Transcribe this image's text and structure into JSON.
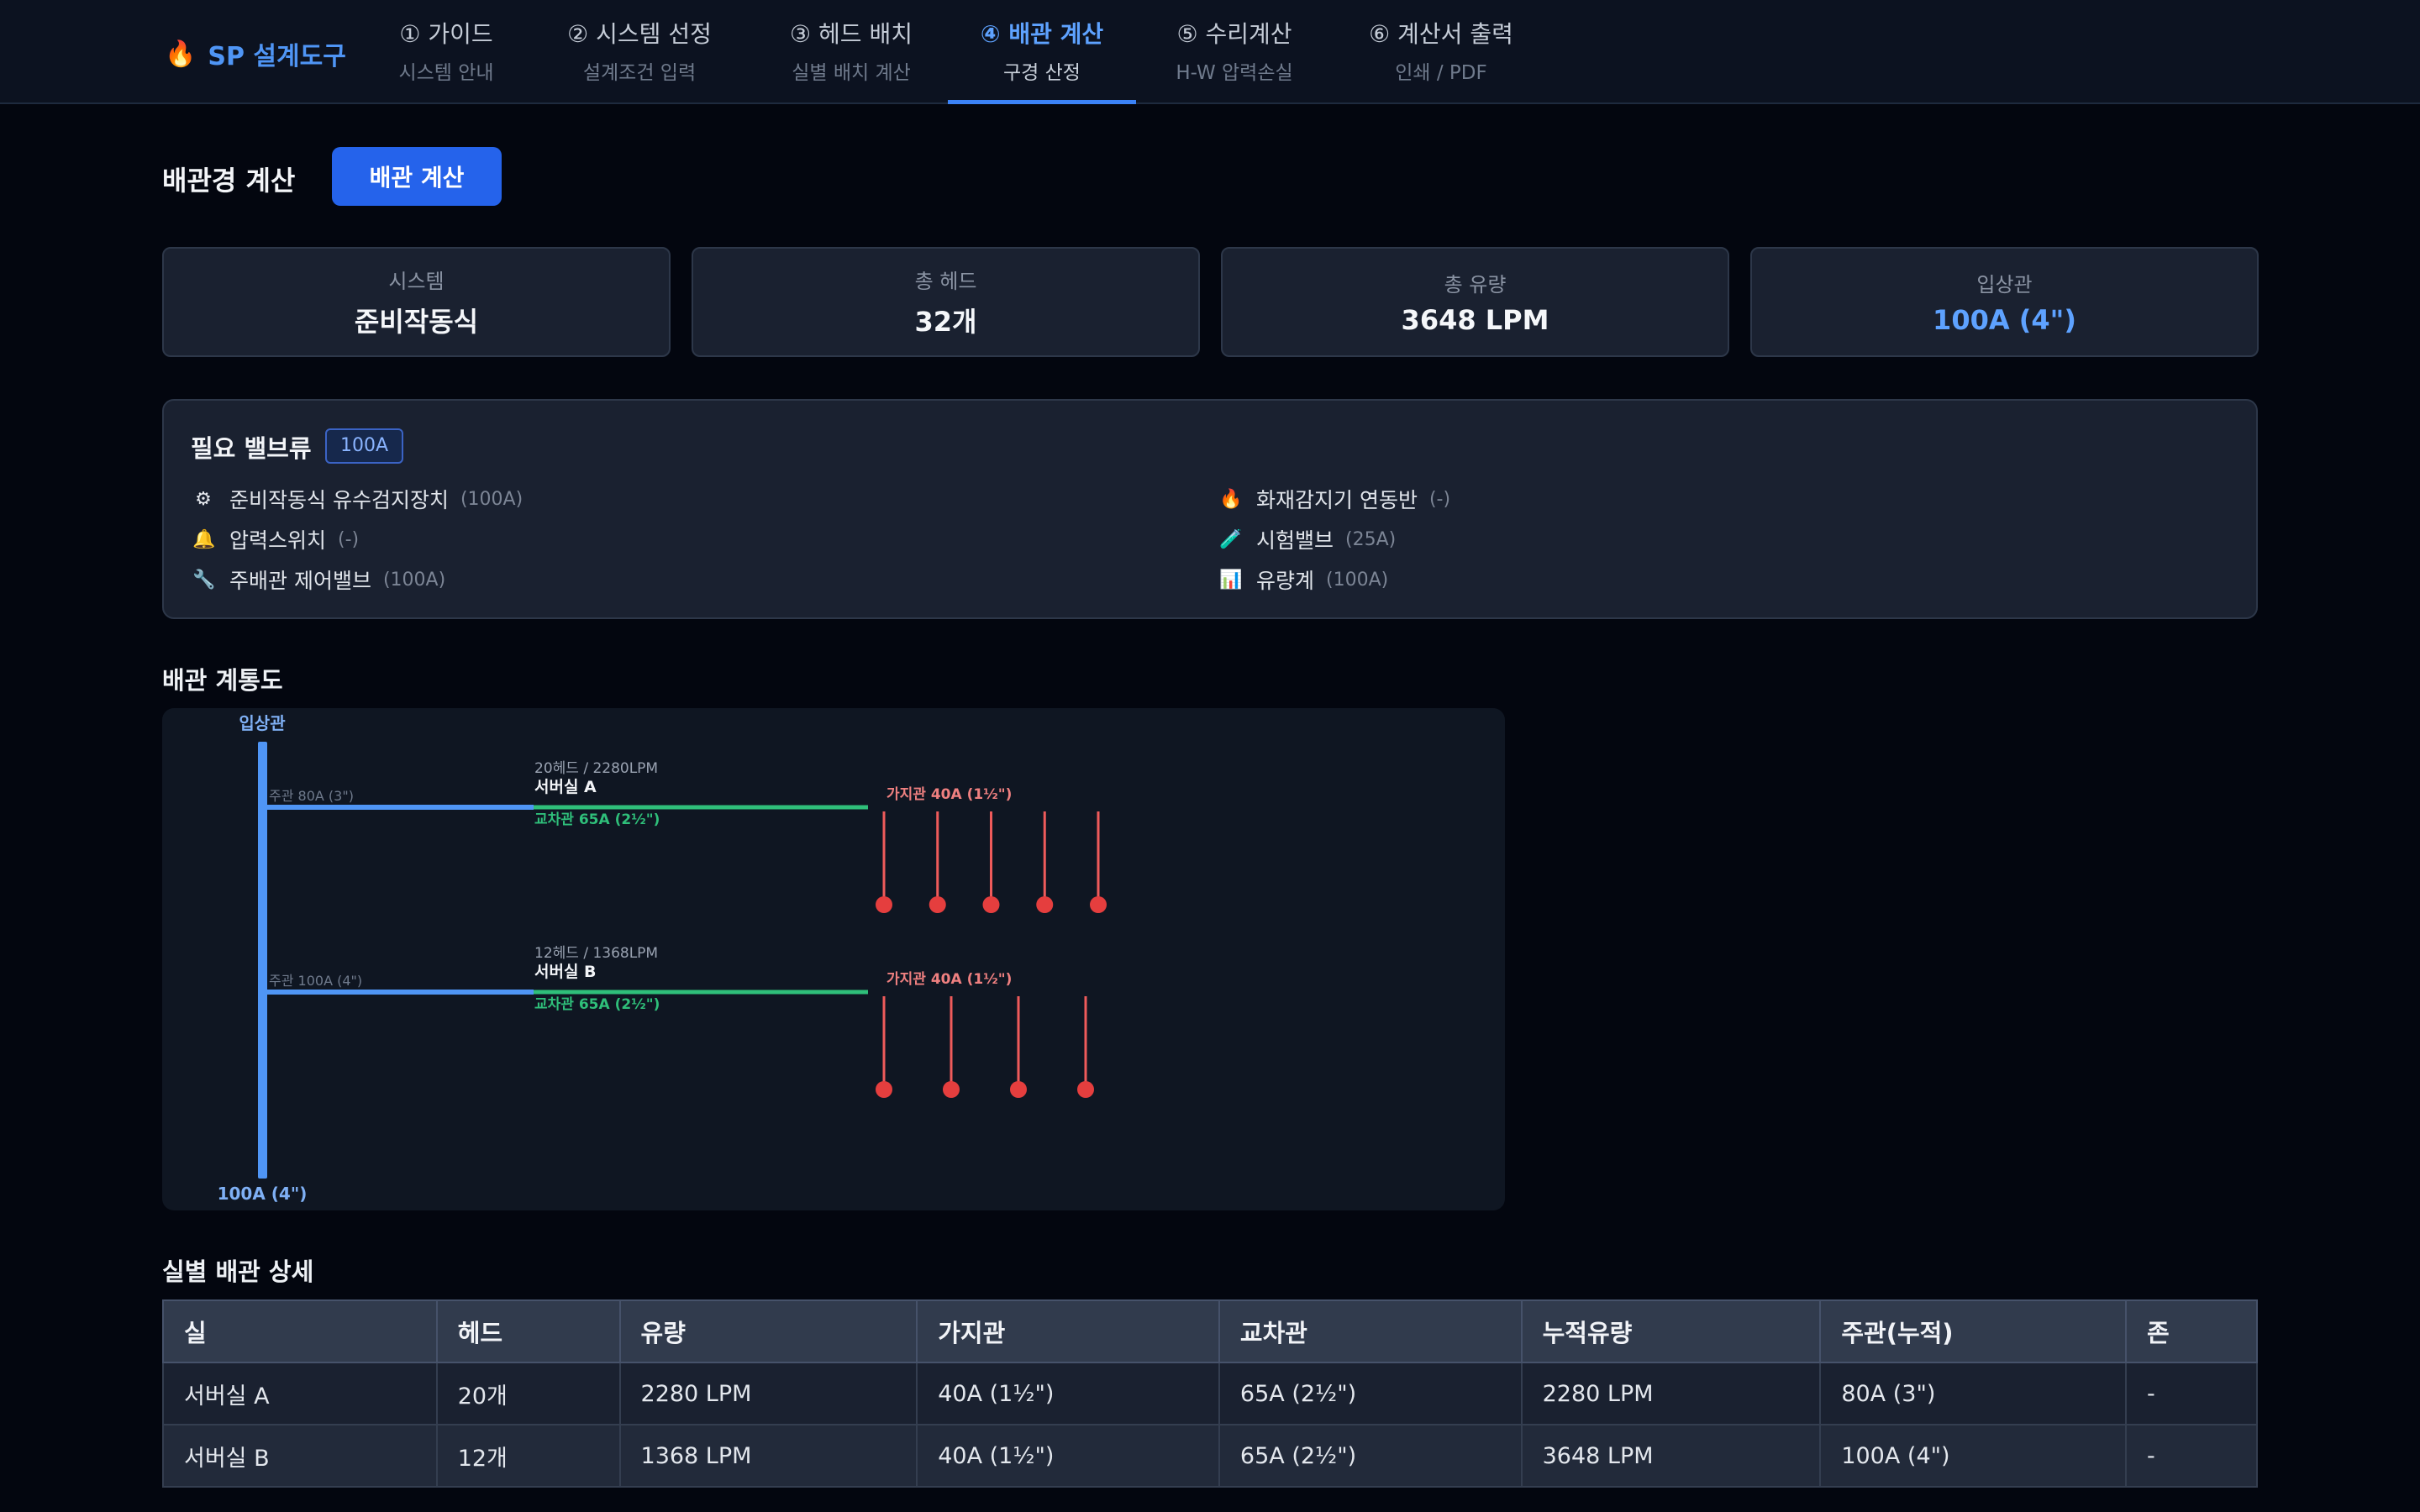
{
  "brand": {
    "icon": "flame-icon",
    "name": "SP 설계도구"
  },
  "tabs": [
    {
      "label": "① 가이드",
      "sub": "시스템 안내",
      "active": false
    },
    {
      "label": "② 시스템 선정",
      "sub": "설계조건 입력",
      "active": false
    },
    {
      "label": "③ 헤드 배치",
      "sub": "실별 배치 계산",
      "active": false
    },
    {
      "label": "④ 배관 계산",
      "sub": "구경 산정",
      "active": true
    },
    {
      "label": "⑤ 수리계산",
      "sub": "H-W 압력손실",
      "active": false
    },
    {
      "label": "⑥ 계산서 출력",
      "sub": "인쇄 / PDF",
      "active": false
    }
  ],
  "main": {
    "title": "배관경 계산",
    "calc_button": "배관 계산",
    "cards": [
      {
        "label": "시스템",
        "value": "준비작동식",
        "accent": false
      },
      {
        "label": "총 헤드",
        "value": "32개",
        "accent": false
      },
      {
        "label": "총 유량",
        "value": "3648 LPM",
        "accent": false
      },
      {
        "label": "입상관",
        "value": "100A (4\")",
        "accent": true
      }
    ],
    "valves": {
      "title": "필요 밸브류",
      "badge": "100A",
      "items": [
        {
          "icon": "gear-icon",
          "glyph": "⚙",
          "name": "준비작동식 유수검지장치",
          "size": "(100A)"
        },
        {
          "icon": "flame-icon",
          "glyph": "🔥",
          "name": "화재감지기 연동반",
          "size": "(-)"
        },
        {
          "icon": "bell-icon",
          "glyph": "🔔",
          "name": "압력스위치",
          "size": "(-)"
        },
        {
          "icon": "test-valve-icon",
          "glyph": "🧪",
          "name": "시험밸브",
          "size": "(25A)"
        },
        {
          "icon": "wrench-icon",
          "glyph": "🔧",
          "name": "주배관 제어밸브",
          "size": "(100A)"
        },
        {
          "icon": "bar-chart-icon",
          "glyph": "📊",
          "name": "유량계",
          "size": "(100A)"
        }
      ]
    },
    "diagram": {
      "title": "배관 계통도",
      "riser_label": "입상관",
      "riser_size": "100A (4\")",
      "colors": {
        "riser": "#4f95f5",
        "cross": "#2fbf7a",
        "branch": "#ef5b5b",
        "head": "#e53e3e"
      },
      "rooms": [
        {
          "name": "서버실 A",
          "info": "20헤드 / 2280LPM",
          "main": "주관 80A (3\")",
          "cross": "교차관 65A (2½\")",
          "branch": "가지관 40A (1½\")",
          "branch_count": 5
        },
        {
          "name": "서버실 B",
          "info": "12헤드 / 1368LPM",
          "main": "주관 100A (4\")",
          "cross": "교차관 65A (2½\")",
          "branch": "가지관 40A (1½\")",
          "branch_count": 4
        }
      ]
    },
    "detail": {
      "title": "실별 배관 상세",
      "headers": [
        "실",
        "헤드",
        "유량",
        "가지관",
        "교차관",
        "누적유량",
        "주관(누적)",
        "존"
      ],
      "rows": [
        [
          "서버실 A",
          "20개",
          "2280 LPM",
          "40A (1½\")",
          "65A (2½\")",
          "2280 LPM",
          "80A (3\")",
          "-"
        ],
        [
          "서버실 B",
          "12개",
          "1368 LPM",
          "40A (1½\")",
          "65A (2½\")",
          "3648 LPM",
          "100A (4\")",
          "-"
        ]
      ]
    }
  }
}
